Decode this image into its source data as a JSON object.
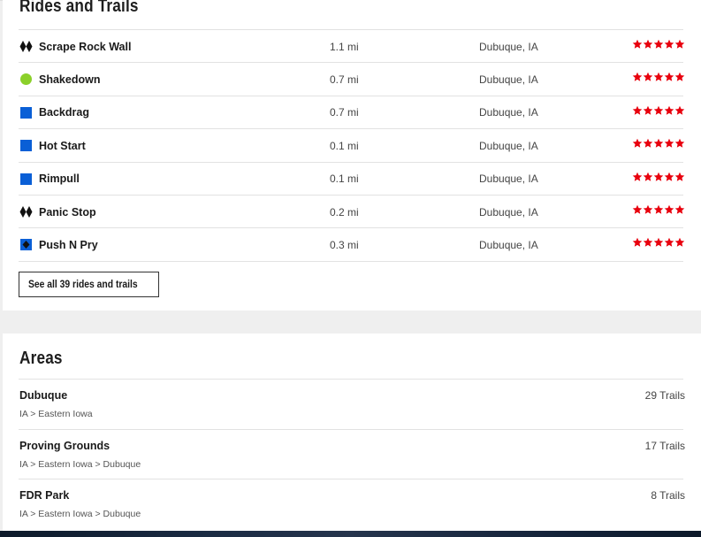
{
  "rides": {
    "title": "Rides and Trails",
    "trails": [
      {
        "name": "Scrape Rock Wall",
        "distance": "1.1 mi",
        "location": "Dubuque, IA",
        "difficulty": "double-black-diamond-icon",
        "rating": 5
      },
      {
        "name": "Shakedown",
        "distance": "0.7 mi",
        "location": "Dubuque, IA",
        "difficulty": "green-circle-icon",
        "rating": 5
      },
      {
        "name": "Backdrag",
        "distance": "0.7 mi",
        "location": "Dubuque, IA",
        "difficulty": "blue-square-icon",
        "rating": 5
      },
      {
        "name": "Hot Start",
        "distance": "0.1 mi",
        "location": "Dubuque, IA",
        "difficulty": "blue-square-icon",
        "rating": 5
      },
      {
        "name": "Rimpull",
        "distance": "0.1 mi",
        "location": "Dubuque, IA",
        "difficulty": "blue-square-icon",
        "rating": 5
      },
      {
        "name": "Panic Stop",
        "distance": "0.2 mi",
        "location": "Dubuque, IA",
        "difficulty": "double-black-diamond-icon",
        "rating": 5
      },
      {
        "name": "Push N Pry",
        "distance": "0.3 mi",
        "location": "Dubuque, IA",
        "difficulty": "blue-black-icon",
        "rating": 5
      }
    ],
    "see_all_label": "See all 39 rides and trails"
  },
  "areas": {
    "title": "Areas",
    "items": [
      {
        "name": "Dubuque",
        "path": "IA > Eastern Iowa",
        "count": "29 Trails"
      },
      {
        "name": "Proving Grounds",
        "path": "IA > Eastern Iowa > Dubuque",
        "count": "17 Trails"
      },
      {
        "name": "FDR Park",
        "path": "IA > Eastern Iowa > Dubuque",
        "count": "8 Trails"
      }
    ]
  },
  "colors": {
    "star": "#e8000d",
    "green": "#8bd02a",
    "blue": "#0a5fd6",
    "black": "#111111"
  }
}
